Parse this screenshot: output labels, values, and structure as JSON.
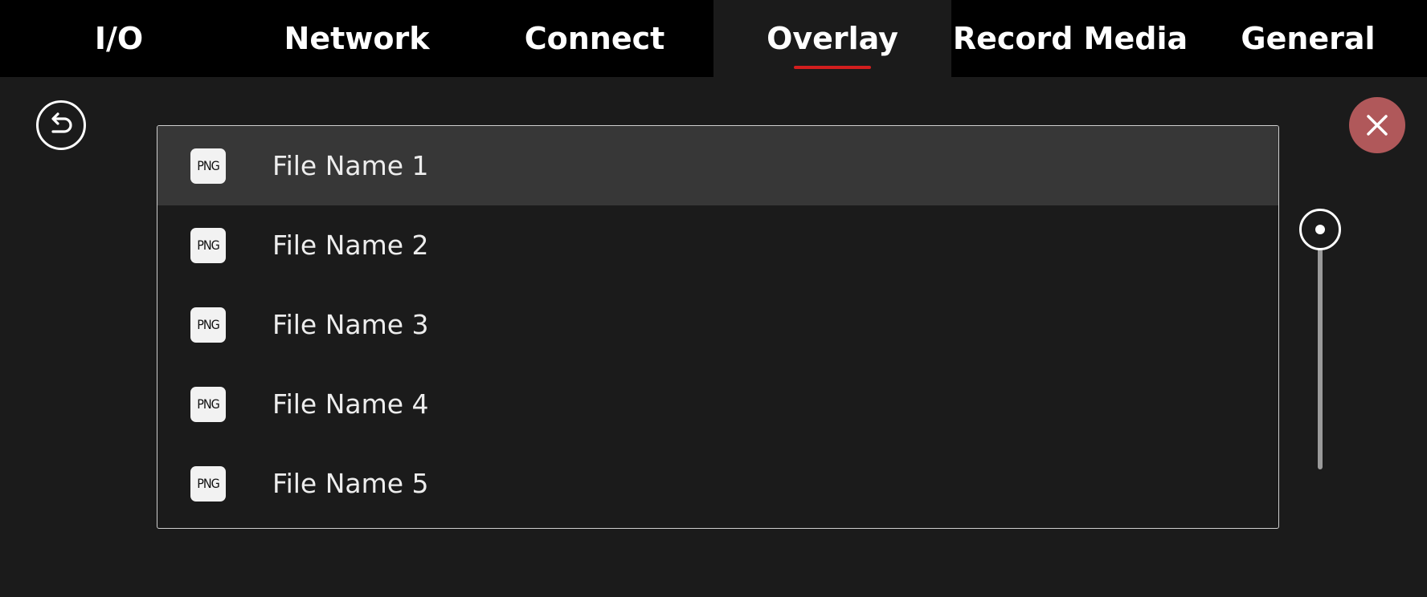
{
  "tabs": [
    {
      "label": "I/O"
    },
    {
      "label": "Network"
    },
    {
      "label": "Connect"
    },
    {
      "label": "Overlay"
    },
    {
      "label": "Record Media"
    },
    {
      "label": "General"
    }
  ],
  "active_tab": "Overlay",
  "colors": {
    "accent_underline": "#d21e1e",
    "close_button": "#b0585a",
    "selected_row": "#373737",
    "background": "#1b1b1b"
  },
  "icons": {
    "back": "undo-arrow-icon",
    "close": "close-icon",
    "file": "png-file-icon"
  },
  "files": [
    {
      "badge": "PNG",
      "name": "File Name 1",
      "selected": true
    },
    {
      "badge": "PNG",
      "name": "File Name 2",
      "selected": false
    },
    {
      "badge": "PNG",
      "name": "File Name 3",
      "selected": false
    },
    {
      "badge": "PNG",
      "name": "File Name 4",
      "selected": false
    },
    {
      "badge": "PNG",
      "name": "File Name 5",
      "selected": false
    }
  ]
}
